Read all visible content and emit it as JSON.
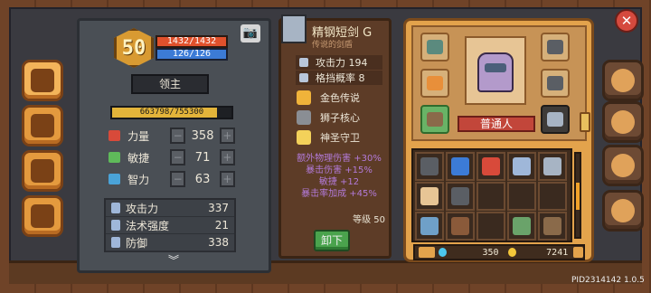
{
  "colors": {
    "hp": "#e0512c",
    "mp": "#3c7bd6",
    "exp": "#e3b43a",
    "unequip": "#4aa34d",
    "rank": "#c2463a",
    "bonus_text": "#b27ad8",
    "close": "#d54a3e"
  },
  "player": {
    "level": "50",
    "hp": "1432/1432",
    "mp": "126/126",
    "title": "领主",
    "exp": "663798/755300",
    "exp_fraction": 0.879
  },
  "attributes": [
    {
      "name": "力量",
      "value": "358",
      "icon": "fist-icon",
      "color": "#d84a3a"
    },
    {
      "name": "敏捷",
      "value": "71",
      "icon": "feather-icon",
      "color": "#5fba5a"
    },
    {
      "name": "智力",
      "value": "63",
      "icon": "book-icon",
      "color": "#4aa3d8"
    }
  ],
  "stat_minus": "−",
  "stat_plus": "+",
  "derived_stats": [
    {
      "name": "攻击力",
      "value": "337"
    },
    {
      "name": "法术强度",
      "value": "21"
    },
    {
      "name": "防御",
      "value": "338"
    }
  ],
  "item": {
    "name": "精钢短剑 G",
    "subtitle": "传说的剑盾",
    "stats": [
      {
        "label": "攻击力 194"
      },
      {
        "label": "格挡概率 8"
      }
    ],
    "perks": [
      {
        "label": "金色传说",
        "icon": "flame-icon"
      },
      {
        "label": "狮子核心",
        "icon": "lion-icon"
      },
      {
        "label": "神圣守卫",
        "icon": "shield-icon"
      }
    ],
    "bonuses": [
      "额外物理伤害 +30%",
      "暴击伤害 +15%",
      "敏捷 +12",
      "暴击率加成 +45%"
    ],
    "level_req": "等级 50",
    "unequip_label": "卸下"
  },
  "equipment": {
    "rank_label": "普通人"
  },
  "currency": {
    "gems": "350",
    "gold": "7241"
  },
  "build": "PID2314142 1.0.5",
  "icons": {
    "camera": "📷",
    "close": "✕",
    "chevron": "︾",
    "portrait": "knight-portrait"
  }
}
